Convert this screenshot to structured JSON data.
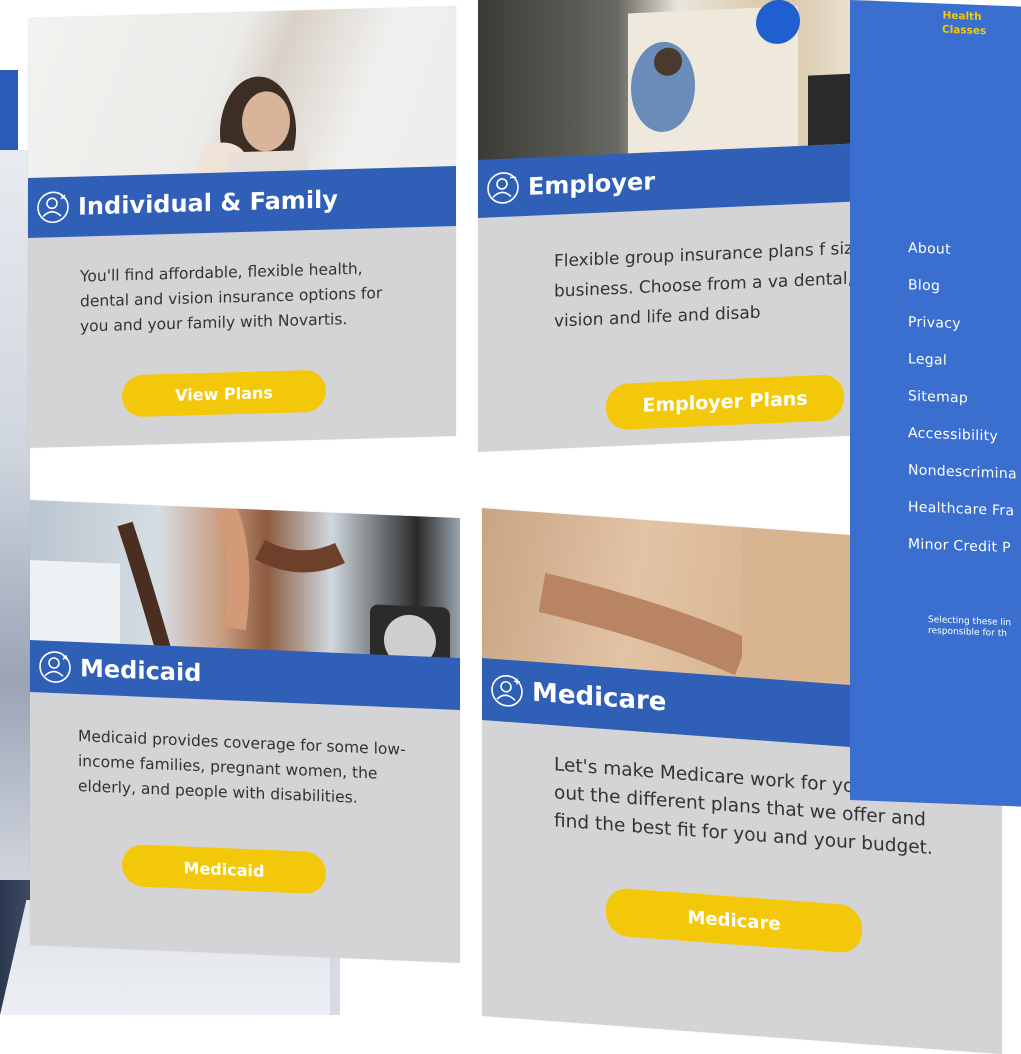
{
  "cards": [
    {
      "title": "Individual & Family",
      "description": "You'll find affordable, flexible health, dental and vision insurance options for you and your family with Novartis.",
      "button": "View Plans"
    },
    {
      "title": "Employer",
      "description": "Flexible group insurance plans f size business. Choose from a va dental, vision and life and disab",
      "button": "Employer Plans"
    },
    {
      "title": "Medicaid",
      "description": "Medicaid provides coverage for some low-income families, pregnant women, the elderly, and people with disabilities.",
      "button": "Medicaid"
    },
    {
      "title": "Medicare",
      "description": "Let's make Medicare work for you. Check out the different plans that we offer and find the best fit for you and your budget.",
      "button": "Medicare"
    }
  ],
  "footer": {
    "top_label": "Health Classes",
    "links": [
      "About",
      "Blog",
      "Privacy",
      "Legal",
      "Sitemap",
      "Accessibility",
      "Nondescrimina",
      "Healthcare Fra",
      "Minor Credit P"
    ],
    "note_line1": "Selecting these lin",
    "note_line2": "responsible for th"
  },
  "colors": {
    "band_blue": "#2f5fb7",
    "button_yellow": "#f3c80a",
    "card_gray": "#d4d4d6",
    "panel_blue": "#3a6fd0"
  }
}
